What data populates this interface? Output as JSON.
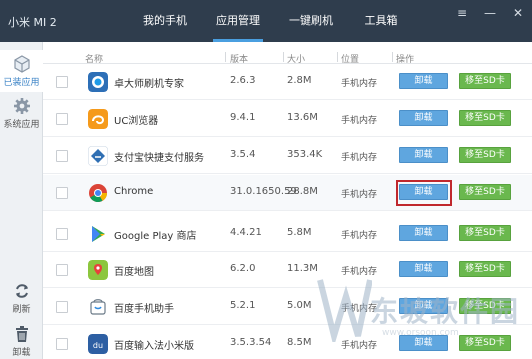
{
  "window": {
    "device_name": "小米 MI 2",
    "menu_glyph": "≡",
    "minimize_glyph": "—",
    "close_glyph": "✕"
  },
  "nav": {
    "tabs": [
      {
        "label": "我的手机"
      },
      {
        "label": "应用管理"
      },
      {
        "label": "一键刷机"
      },
      {
        "label": "工具箱"
      }
    ],
    "active": "应用管理"
  },
  "sidebar": {
    "items": [
      {
        "label": "已装应用",
        "icon": "box-icon"
      },
      {
        "label": "系统应用",
        "icon": "gear-icon"
      },
      {
        "label": "刷新",
        "icon": "refresh-icon"
      },
      {
        "label": "卸载",
        "icon": "trash-icon"
      }
    ]
  },
  "table": {
    "columns": [
      "名称",
      "版本",
      "大小",
      "位置",
      "操作"
    ],
    "uninstall_label": "卸载",
    "move_label": "移至SD卡",
    "rows": [
      {
        "name": "卓大师刷机专家",
        "version": "2.6.3",
        "size": "2.8M",
        "location": "手机内存",
        "icon": "zhuodashi-icon"
      },
      {
        "name": "UC浏览器",
        "version": "9.4.1",
        "size": "13.6M",
        "location": "手机内存",
        "icon": "uc-browser-icon"
      },
      {
        "name": "支付宝快捷支付服务",
        "version": "3.5.4",
        "size": "353.4K",
        "location": "手机内存",
        "icon": "alipay-icon"
      },
      {
        "name": "Chrome",
        "version": "31.0.1650.59",
        "size": "28.8M",
        "location": "手机内存",
        "icon": "chrome-icon"
      },
      {
        "name": "Google Play 商店",
        "version": "4.4.21",
        "size": "5.8M",
        "location": "手机内存",
        "icon": "google-play-icon"
      },
      {
        "name": "百度地图",
        "version": "6.2.0",
        "size": "11.3M",
        "location": "手机内存",
        "icon": "baidu-map-icon"
      },
      {
        "name": "百度手机助手",
        "version": "5.2.1",
        "size": "5.0M",
        "location": "手机内存",
        "icon": "baidu-assistant-icon"
      },
      {
        "name": "百度输入法小米版",
        "version": "3.5.3.54",
        "size": "8.5M",
        "location": "手机内存",
        "icon": "baidu-input-icon"
      }
    ]
  },
  "watermark": {
    "text": "东坡软件园",
    "url": "www.orsoon.com"
  },
  "colors": {
    "topbar": "#2f3d4d",
    "accent": "#4a9fe0",
    "uninstall_button": "#5fa6df",
    "move_button": "#6ab84e",
    "highlight_box": "#c0282d"
  }
}
